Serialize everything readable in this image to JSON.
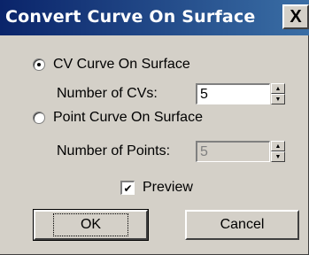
{
  "dialog": {
    "title": "Convert Curve On Surface",
    "close_label": "X"
  },
  "options": {
    "cv": {
      "label": "CV Curve On Surface",
      "selected": true,
      "count_label": "Number of CVs:",
      "count_value": "5"
    },
    "point": {
      "label": "Point Curve On Surface",
      "selected": false,
      "count_label": "Number of Points:",
      "count_value": "5"
    }
  },
  "preview": {
    "label": "Preview",
    "checked": true
  },
  "buttons": {
    "ok": "OK",
    "cancel": "Cancel"
  },
  "icons": {
    "spin_up": "▲",
    "spin_down": "▼",
    "checkmark": "✔"
  }
}
